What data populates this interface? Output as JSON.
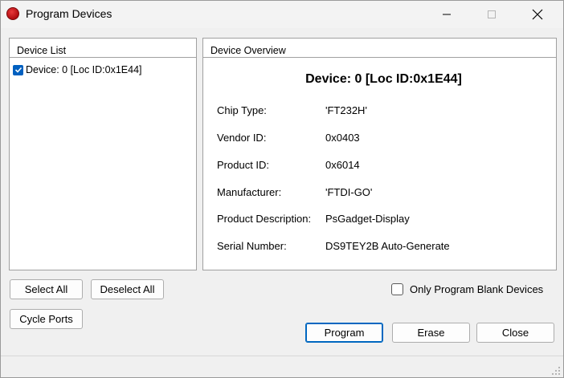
{
  "window": {
    "title": "Program Devices",
    "icon": "red-circle-app-icon"
  },
  "device_list": {
    "header": "Device List",
    "items": [
      {
        "label": "Device: 0 [Loc ID:0x1E44]",
        "checked": true
      }
    ]
  },
  "device_overview": {
    "header": "Device Overview",
    "title": "Device: 0 [Loc ID:0x1E44]",
    "fields": [
      {
        "label": "Chip Type:",
        "value": "'FT232H'"
      },
      {
        "label": "Vendor ID:",
        "value": "0x0403"
      },
      {
        "label": "Product ID:",
        "value": "0x6014"
      },
      {
        "label": "Manufacturer:",
        "value": "'FTDI-GO'"
      },
      {
        "label": "Product Description:",
        "value": "PsGadget-Display"
      },
      {
        "label": "Serial Number:",
        "value": "DS9TEY2B Auto-Generate"
      }
    ]
  },
  "buttons": {
    "select_all": "Select All",
    "deselect_all": "Deselect All",
    "cycle_ports": "Cycle Ports",
    "program": "Program",
    "erase": "Erase",
    "close": "Close"
  },
  "options": {
    "only_blank_label": "Only Program Blank Devices",
    "only_blank_checked": false
  },
  "colors": {
    "accent": "#0067c0",
    "app_icon": "#c8191c"
  }
}
